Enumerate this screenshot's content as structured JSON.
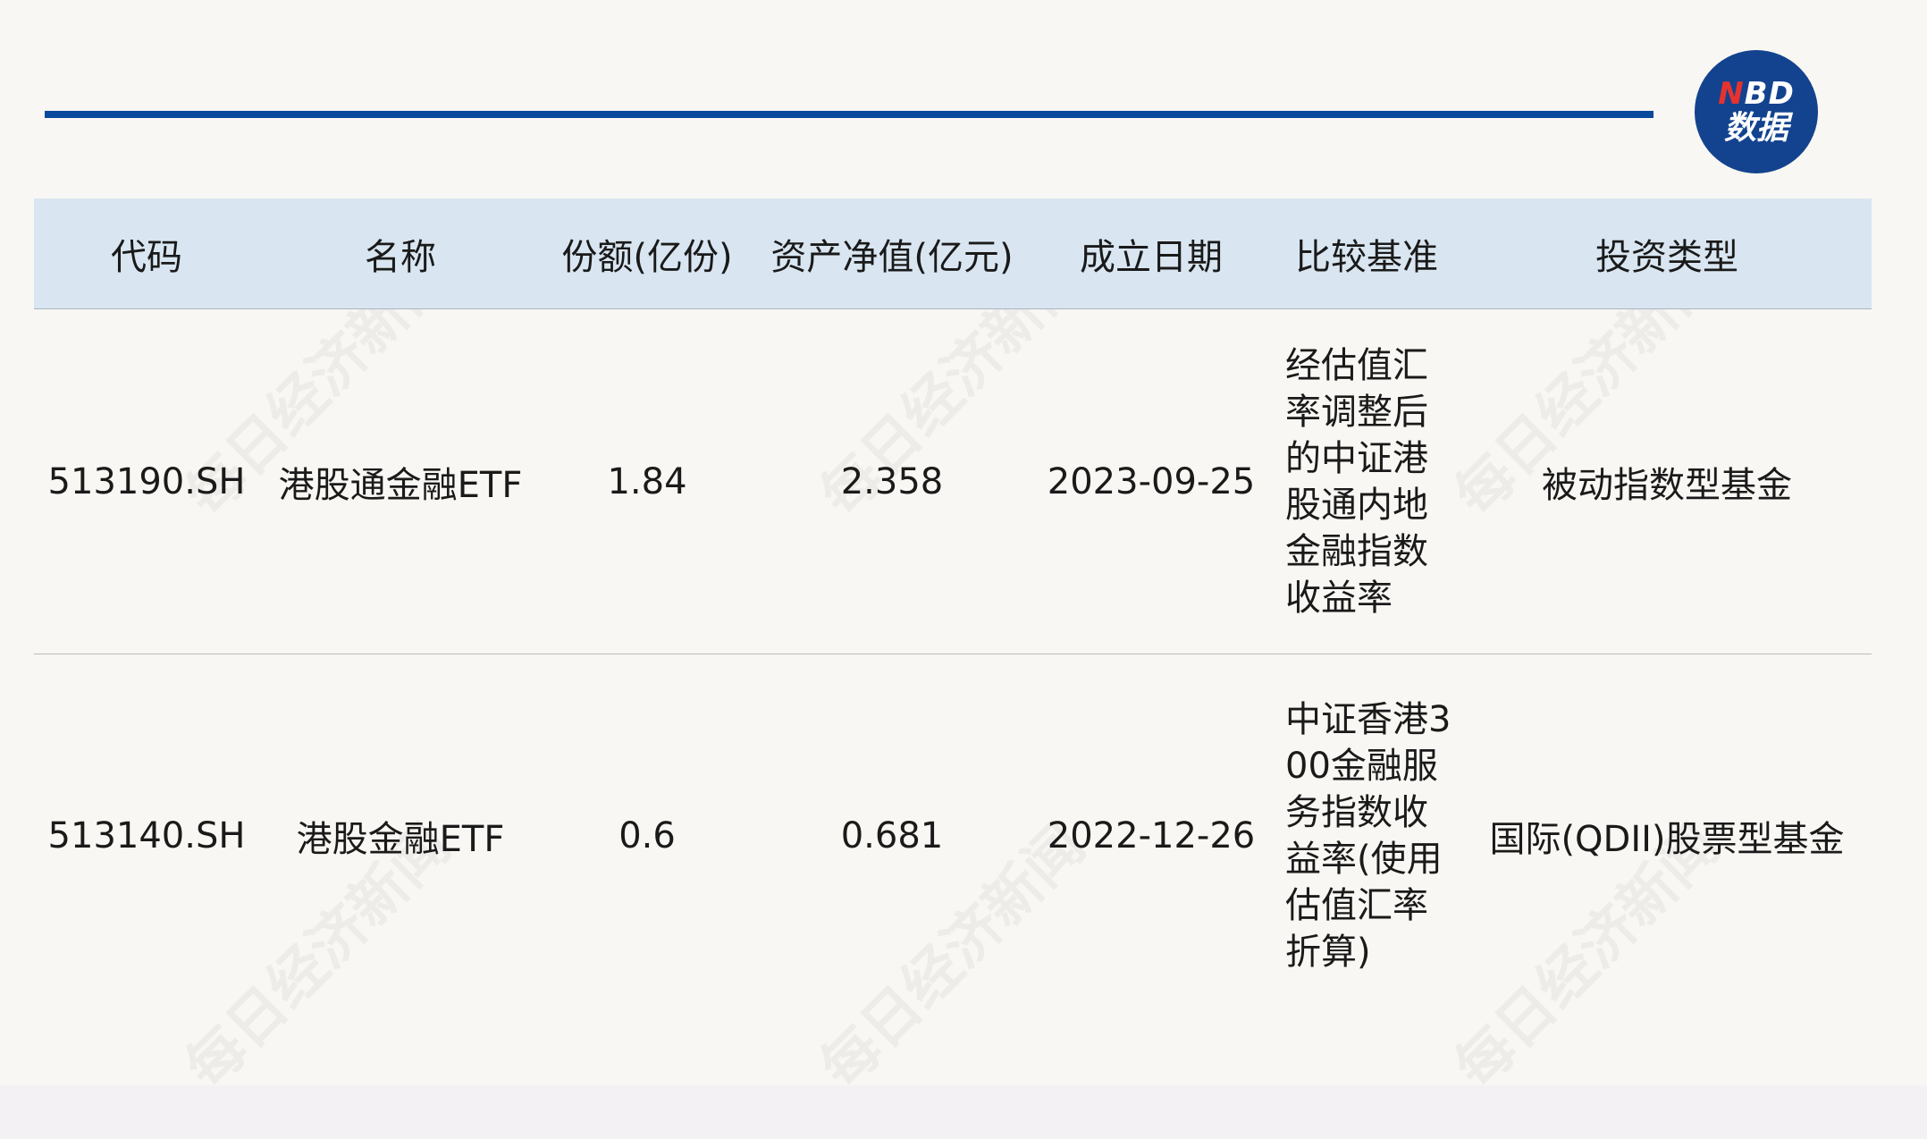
{
  "logo": {
    "line1_n": "N",
    "line1_rest": "BD",
    "line2": "数据"
  },
  "watermark": "每日经济新闻",
  "table": {
    "headers": [
      "代码",
      "名称",
      "份额(亿份)",
      "资产净值(亿元)",
      "成立日期",
      "比较基准",
      "投资类型"
    ],
    "rows": [
      {
        "code": "513190.SH",
        "name": "港股通金融ETF",
        "shares": "1.84",
        "nav": "2.358",
        "date": "2023-09-25",
        "benchmark": "经估值汇率调整后的中证港股通内地金融指数收益率",
        "type": "被动指数型基金"
      },
      {
        "code": "513140.SH",
        "name": "港股金融ETF",
        "shares": "0.6",
        "nav": "0.681",
        "date": "2022-12-26",
        "benchmark": "中证香港300金融服务指数收益率(使用估值汇率折算)",
        "type": "国际(QDII)股票型基金"
      }
    ]
  },
  "colors": {
    "rule": "#0a4a9c",
    "header_bg": "#d9e6f1",
    "logo_bg": "#13438f",
    "logo_accent": "#e8322e"
  }
}
